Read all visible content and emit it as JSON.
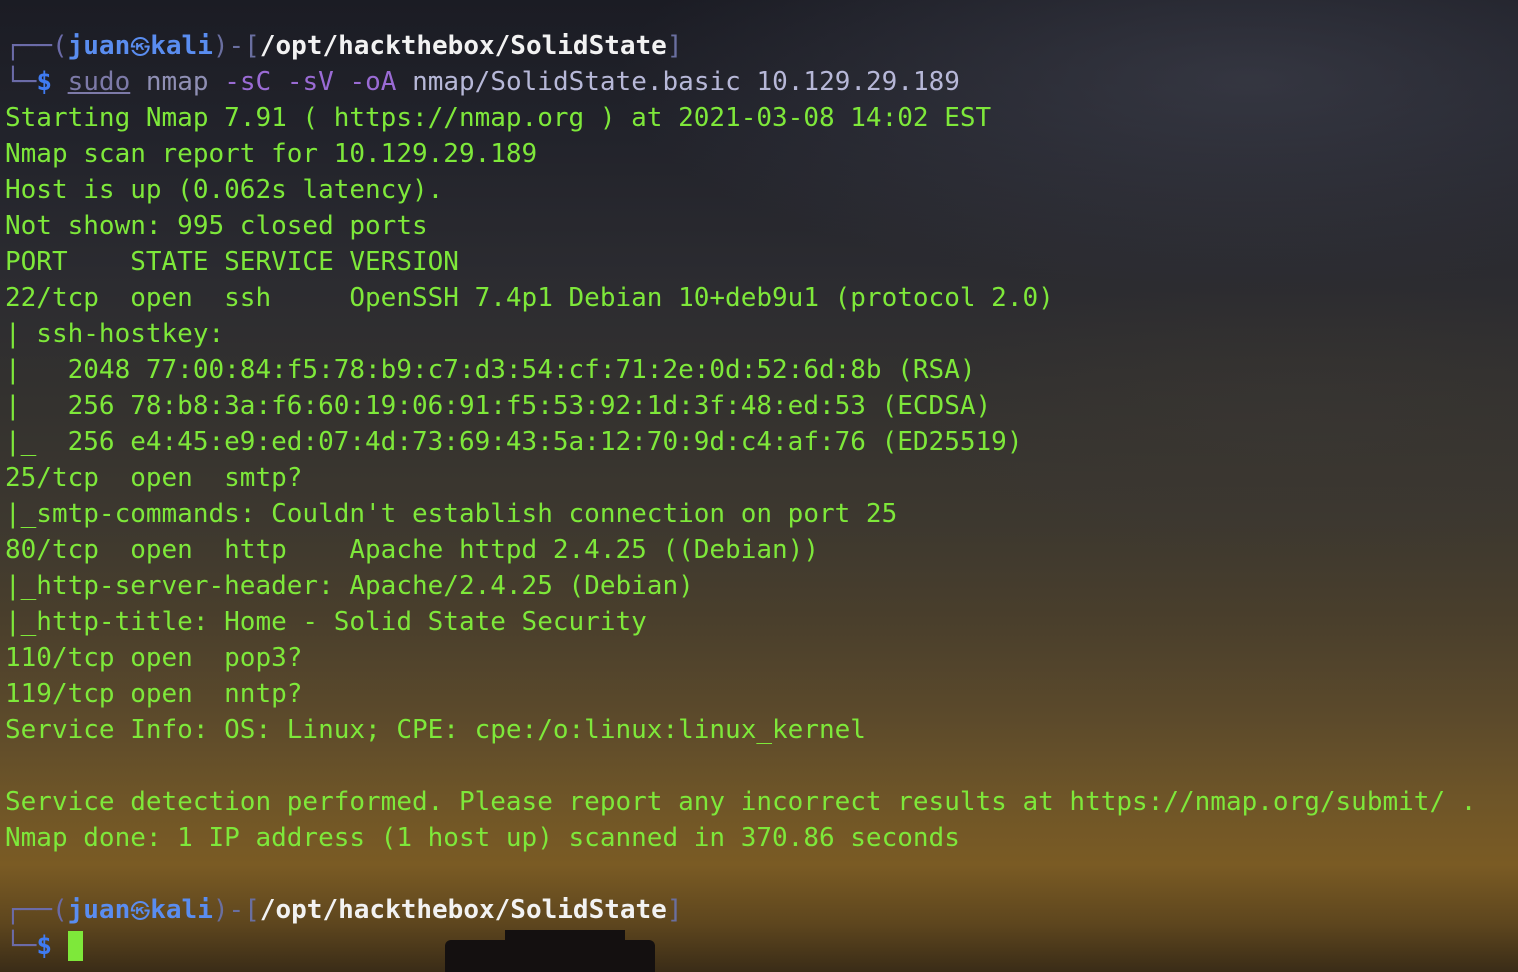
{
  "prompt": {
    "corner_top": "┌──(",
    "corner_bottom": "└─",
    "user": "juan",
    "skull_glyph": "㉿",
    "host": "kali",
    "sep": ")-[",
    "path": "/opt/hackthebox/SolidState",
    "close": "]",
    "dollar": "$"
  },
  "command": {
    "sudo": "sudo",
    "nmap": "nmap",
    "flag_sC": "-sC",
    "flag_sV": "-sV",
    "flag_oA": "-oA",
    "output": "nmap/SolidState.basic",
    "target": "10.129.29.189"
  },
  "output_lines": [
    "Starting Nmap 7.91 ( https://nmap.org ) at 2021-03-08 14:02 EST",
    "Nmap scan report for 10.129.29.189",
    "Host is up (0.062s latency).",
    "Not shown: 995 closed ports",
    "PORT    STATE SERVICE VERSION",
    "22/tcp  open  ssh     OpenSSH 7.4p1 Debian 10+deb9u1 (protocol 2.0)",
    "| ssh-hostkey:",
    "|   2048 77:00:84:f5:78:b9:c7:d3:54:cf:71:2e:0d:52:6d:8b (RSA)",
    "|   256 78:b8:3a:f6:60:19:06:91:f5:53:92:1d:3f:48:ed:53 (ECDSA)",
    "|_  256 e4:45:e9:ed:07:4d:73:69:43:5a:12:70:9d:c4:af:76 (ED25519)",
    "25/tcp  open  smtp?",
    "|_smtp-commands: Couldn't establish connection on port 25",
    "80/tcp  open  http    Apache httpd 2.4.25 ((Debian))",
    "|_http-server-header: Apache/2.4.25 (Debian)",
    "|_http-title: Home - Solid State Security",
    "110/tcp open  pop3?",
    "119/tcp open  nntp?",
    "Service Info: OS: Linux; CPE: cpe:/o:linux:linux_kernel",
    "",
    "Service detection performed. Please report any incorrect results at https://nmap.org/submit/ .",
    "Nmap done: 1 IP address (1 host up) scanned in 370.86 seconds"
  ],
  "colors": {
    "output_green": "#7ee83a",
    "prompt_blue": "#5a8df0",
    "path_white": "#f2f2f2",
    "flag_purple": "#9a6bd4"
  }
}
